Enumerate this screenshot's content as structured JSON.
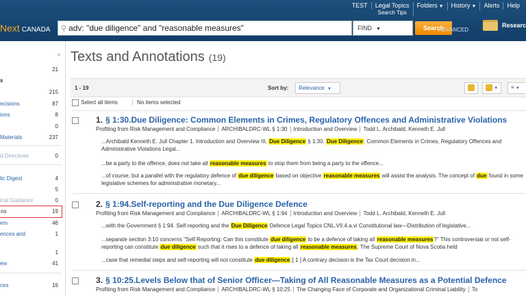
{
  "header": {
    "util_links": [
      {
        "label": "TEST"
      },
      {
        "label": "Legal Topics",
        "sub": "Search Tips"
      },
      {
        "label": "Folders"
      },
      {
        "label": "History"
      },
      {
        "label": "Alerts"
      },
      {
        "label": "Help"
      }
    ],
    "logo_text": "Next",
    "logo_country": "CANADA",
    "search_value": "adv: \"due diligence\" and \"reasonable measures\"",
    "find_label": "FIND",
    "search_button": "Search",
    "advanced_label": "ADVANCED",
    "research_label": "Research"
  },
  "sidebar": {
    "items": [
      {
        "label": "",
        "count": "21"
      },
      {
        "label": "s",
        "count": ""
      },
      {
        "label": "",
        "count": "215"
      },
      {
        "label": "ecisions",
        "count": "87"
      },
      {
        "label": "ions",
        "count": "8"
      },
      {
        "label": "",
        "count": "0"
      },
      {
        "label": "Materials",
        "count": "237"
      },
      {
        "label": "d Directives",
        "count": "0"
      },
      {
        "label": "lic Digest",
        "count": "4"
      },
      {
        "label": "",
        "count": "5"
      },
      {
        "label": "ical Guidance",
        "count": "0"
      },
      {
        "label": "ns",
        "count": "19"
      },
      {
        "label": "ers",
        "count": "46"
      },
      {
        "label": "ences and",
        "count": "1"
      },
      {
        "label": "",
        "count": "1"
      },
      {
        "label": "ew",
        "count": "41"
      },
      {
        "label": "ces",
        "count": "16"
      }
    ]
  },
  "main": {
    "title": "Texts and Annotations",
    "title_count": "(19)",
    "range": "1 - 19",
    "sort_label": "Sort by:",
    "sort_value": "Relevance",
    "select_all": "Select all items",
    "no_selected": "No items selected",
    "results": [
      {
        "num": "1.",
        "title": "§ 1:30.Due Diligence: Common Elements in Crimes, Regulatory Offences and Administrative Violations",
        "meta": [
          "Profiting from Risk Management and Compliance",
          "ARCHIBALDRC-WL § 1:30",
          "Introduction and Overview",
          "Todd L. Archibald, Kenneth E. Jull"
        ],
        "s1a": "...Archibald Kenneth E. Jull Chapter 1. Introduction and Overview III. ",
        "s1h1": "Due Diligence",
        "s1b": " § 1:30. ",
        "s1h2": "Due Diligence",
        "s1c": ": Common Elements in Crimes, Regulatory Offences and Administrative Violations Legal...",
        "s2a": "...be a party to the offence, does not take all ",
        "s2h": "reasonable measures",
        "s2b": " to stop them from being a party to the offence...",
        "s3a": "...of course, but a parallel with the regulatory defence of ",
        "s3h1": "due diligence",
        "s3b": " based on objective ",
        "s3h2": "reasonable measures",
        "s3c": " will assist the analysis. The concept of ",
        "s3h3": "due",
        "s3d": " found in some legislative schemes for administrative monetary..."
      },
      {
        "num": "2.",
        "title": "§ 1:94.Self-reporting and the Due Diligence Defence",
        "meta": [
          "Profiting from Risk Management and Compliance",
          "ARCHIBALDRC-WL § 1:94",
          "Introduction and Overview",
          "Todd L. Archibald, Kenneth E. Jull"
        ],
        "s1a": "...with the Government § 1:94. Self-reporting and the ",
        "s1h": "Due Diligence",
        "s1b": " Defence Legal Topics CNL.VII.4.a.vi Constitutional law—Distribution of legislative...",
        "s2a": "...separate section 3:10 concerns \"Self Reporting: Can this constitute ",
        "s2h1": "due diligence",
        "s2b": " to be a defence of taking all ",
        "s2h2": "reasonable measures",
        "s2c": "?\" This controversial or not self-reporting can constitute ",
        "s2h3": "due diligence",
        "s2d": " such that it rises to a defence of taking all ",
        "s2h4": "reasonable measures",
        "s2e": ". The Supreme Court of Nova Scotia held",
        "s3a": "...case that remedial steps and self-reporting will not constitute ",
        "s3h": "due diligence",
        "s3b": ".[ 1 ] A contrary decision is the Tax Court decision in..."
      },
      {
        "num": "3.",
        "title": "§ 10:25.Levels Below that of Senior Officer—Taking of All Reasonable Measures as a Potential Defence",
        "meta": [
          "Profiting from Risk Management and Compliance",
          "ARCHIBALDRC-WL § 10:25",
          "The Changing Face of Corporate and Organizational Criminal Liability",
          "To"
        ]
      }
    ]
  }
}
